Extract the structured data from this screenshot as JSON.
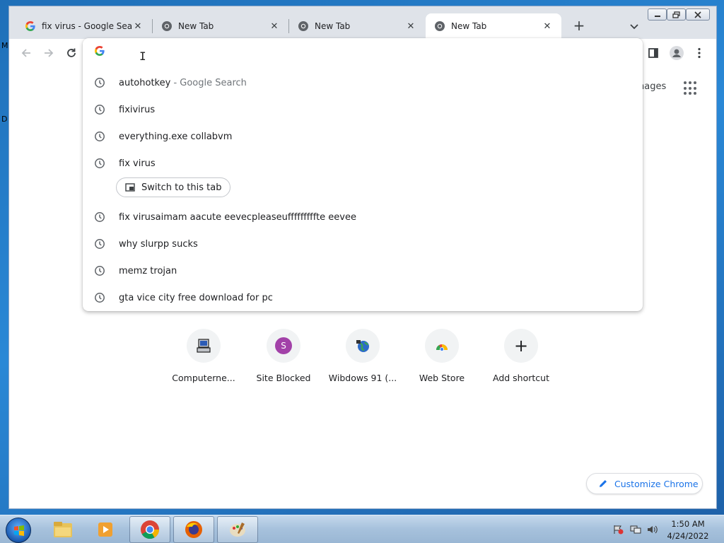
{
  "desktop": {
    "frag_m": "M",
    "frag_d": "D"
  },
  "tabs": [
    {
      "title": "fix virus - Google Search",
      "icon": "google-g-icon",
      "active": false
    },
    {
      "title": "New Tab",
      "icon": "chrome-icon",
      "active": false
    },
    {
      "title": "New Tab",
      "icon": "chrome-icon",
      "active": false
    },
    {
      "title": "New Tab",
      "icon": "chrome-icon",
      "active": true
    }
  ],
  "tab_close_glyph": "✕",
  "newtab_glyph": "+",
  "apps_link_visible": "nages",
  "omnibox": {
    "value": "",
    "suggestions": [
      {
        "text": "autohotkey",
        "sub": " - Google Search"
      },
      {
        "text": "fixivirus",
        "sub": ""
      },
      {
        "text": "everything.exe collabvm",
        "sub": ""
      },
      {
        "text": "fix virus",
        "sub": ""
      },
      {
        "text": "fix virusaimam aacute eevecpleaseufffffffffte eevee",
        "sub": ""
      },
      {
        "text": "why slurpp sucks",
        "sub": ""
      },
      {
        "text": "memz trojan",
        "sub": ""
      },
      {
        "text": "gta vice city free download for pc",
        "sub": ""
      }
    ],
    "switch_tab_label": "Switch to this tab"
  },
  "shortcuts": [
    {
      "label": "Computerne...",
      "icon": "computer-icon"
    },
    {
      "label": "Site Blocked",
      "icon": "letter-s-icon",
      "letter": "S"
    },
    {
      "label": "Wibdows 91 (...",
      "icon": "globe-icon"
    },
    {
      "label": "Web Store",
      "icon": "webstore-icon"
    },
    {
      "label": "Add shortcut",
      "icon": "plus-icon",
      "glyph": "+"
    }
  ],
  "customize_label": "Customize Chrome",
  "taskbar": {
    "apps": [
      "explorer",
      "media-player",
      "chrome",
      "firefox",
      "paint"
    ],
    "time": "1:50 AM",
    "date": "4/24/2022"
  }
}
